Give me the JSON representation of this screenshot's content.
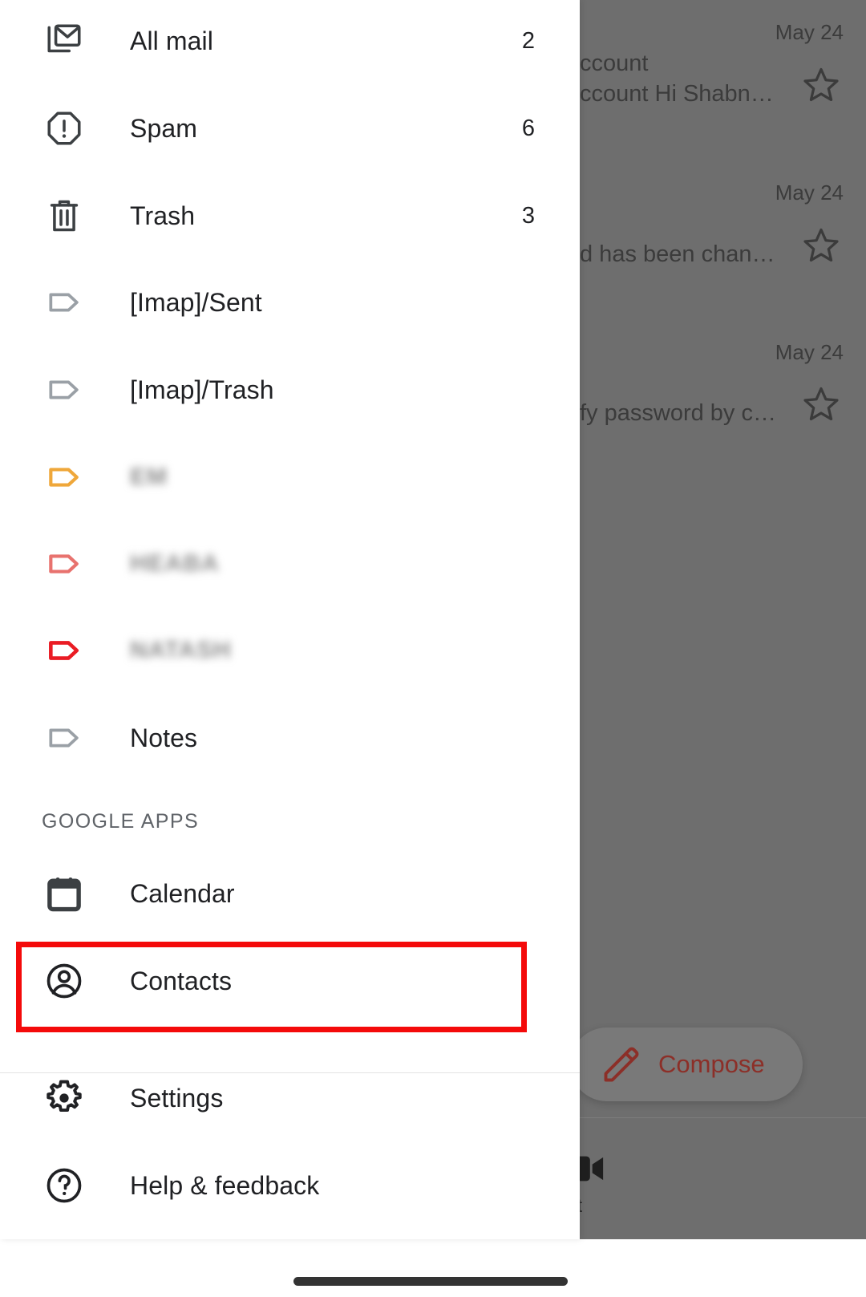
{
  "drawer": {
    "folders": [
      {
        "label": "All mail",
        "count": "2",
        "icon": "all-mail-icon",
        "icon_color": "#3c4043"
      },
      {
        "label": "Spam",
        "count": "6",
        "icon": "spam-icon",
        "icon_color": "#3c4043"
      },
      {
        "label": "Trash",
        "count": "3",
        "icon": "trash-icon",
        "icon_color": "#3c4043"
      }
    ],
    "labels": [
      {
        "label": "[Imap]/Sent",
        "icon": "label-icon",
        "icon_color": "#9aa0a6",
        "redacted": false
      },
      {
        "label": "[Imap]/Trash",
        "icon": "label-icon",
        "icon_color": "#9aa0a6",
        "redacted": false
      },
      {
        "label": "EM",
        "icon": "label-icon",
        "icon_color": "#efa73a",
        "redacted": true
      },
      {
        "label": "HEABA",
        "icon": "label-icon",
        "icon_color": "#e8726e",
        "redacted": true
      },
      {
        "label": "NATASH",
        "icon": "label-icon",
        "icon_color": "#ea1c24",
        "redacted": true
      },
      {
        "label": "Notes",
        "icon": "label-icon",
        "icon_color": "#9aa0a6",
        "redacted": false
      }
    ],
    "section_header": "GOOGLE APPS",
    "google_apps": [
      {
        "label": "Calendar",
        "icon": "calendar-icon"
      },
      {
        "label": "Contacts",
        "icon": "account-circle-icon",
        "highlighted": true
      }
    ],
    "footer": [
      {
        "label": "Settings",
        "icon": "gear-icon"
      },
      {
        "label": "Help & feedback",
        "icon": "help-circle-icon"
      }
    ]
  },
  "highlight": {
    "target": "Contacts",
    "color": "#f40a0a"
  },
  "background_app": {
    "mail_rows": [
      {
        "date": "May 24",
        "sender": "ccount",
        "snippet": "ccount Hi Shabn…",
        "star": "star-outline-icon"
      },
      {
        "date": "May 24",
        "sender": "",
        "snippet": "d has been chan…",
        "star": "star-outline-icon"
      },
      {
        "date": "May 24",
        "sender": "",
        "snippet": "fy password by c…",
        "star": "star-outline-icon"
      }
    ],
    "compose": {
      "label": "Compose",
      "icon": "pencil-icon",
      "color": "#8c2f28"
    },
    "bottom_nav": {
      "label": "et",
      "icon": "meet-video-icon"
    }
  }
}
